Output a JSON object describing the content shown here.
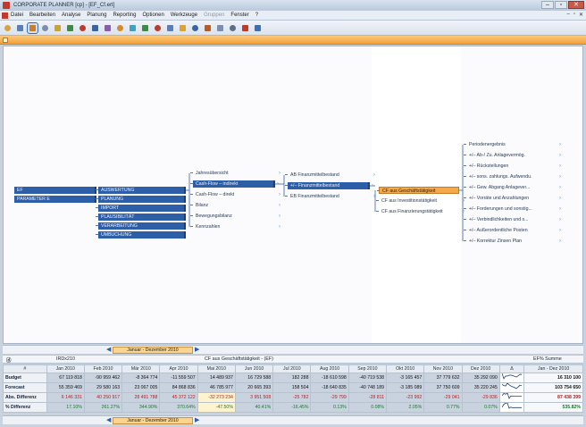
{
  "window": {
    "title": "CORPORATE PLANNER [cp] - [EF_Cf.ert]",
    "controls": [
      "–",
      "▫",
      "✕"
    ]
  },
  "menu": {
    "items": [
      {
        "label": "Datei",
        "enabled": true
      },
      {
        "label": "Bearbeiten",
        "enabled": true
      },
      {
        "label": "Analyse",
        "enabled": true
      },
      {
        "label": "Planung",
        "enabled": true
      },
      {
        "label": "Reporting",
        "enabled": true
      },
      {
        "label": "Optionen",
        "enabled": true
      },
      {
        "label": "Werkzeuge",
        "enabled": true
      },
      {
        "label": "Gruppen",
        "enabled": false
      },
      {
        "label": "Fenster",
        "enabled": true
      },
      {
        "label": "?",
        "enabled": true
      }
    ],
    "mdi_controls": [
      "–",
      "▫",
      "✕"
    ]
  },
  "toolbar": {
    "icons": [
      {
        "name": "open-icon",
        "color": "#d9a33a"
      },
      {
        "name": "tree-icon",
        "color": "#5a7fb8"
      },
      {
        "name": "structure-icon",
        "color": "#c97f2a",
        "active": true
      },
      {
        "name": "table-icon",
        "color": "#7a8fb0"
      },
      {
        "name": "report-icon",
        "color": "#c9a33a"
      },
      {
        "name": "chart-icon",
        "color": "#3f8a48"
      },
      {
        "name": "arrow-icon",
        "color": "#c0392b"
      },
      {
        "name": "plan-icon",
        "color": "#3766a8"
      },
      {
        "name": "graph-icon",
        "color": "#8a5bb5"
      },
      {
        "name": "clock-icon",
        "color": "#d58b2a"
      },
      {
        "name": "globe-icon",
        "color": "#3fa0c8"
      },
      {
        "name": "pin-icon",
        "color": "#3f8a48"
      },
      {
        "name": "line-chart-icon",
        "color": "#c0392b"
      },
      {
        "name": "grid-icon",
        "color": "#5a7fb8"
      },
      {
        "name": "calendar-icon",
        "color": "#d9a33a"
      },
      {
        "name": "nodes-icon",
        "color": "#3766a8"
      },
      {
        "name": "flow-icon",
        "color": "#b85a2a"
      },
      {
        "name": "filter-icon",
        "color": "#7a8fb0"
      },
      {
        "name": "print-icon",
        "color": "#5a6f88"
      },
      {
        "name": "save-icon",
        "color": "#c0392b"
      },
      {
        "name": "export-icon",
        "color": "#3f6fb0"
      }
    ]
  },
  "tree": {
    "col1": [
      {
        "label": "EF",
        "style": "blue"
      },
      {
        "label": "PARAMETER E",
        "style": "blue"
      }
    ],
    "col2": [
      {
        "label": "AUSWERTUNG",
        "style": "blue"
      },
      {
        "label": "PLANUNG",
        "style": "blue"
      },
      {
        "label": "IMPORT",
        "style": "blue"
      },
      {
        "label": "PLAUSIBILITÄT",
        "style": "blue"
      },
      {
        "label": "VERARBEITUNG",
        "style": "blue"
      },
      {
        "label": "UMBUCHUNG",
        "style": "blue"
      }
    ],
    "col3": [
      {
        "label": "Jahresübersicht",
        "style": "plain"
      },
      {
        "label": "Cash-Flow – indirekt",
        "style": "blue"
      },
      {
        "label": "Cash-Flow – direkt",
        "style": "plain"
      },
      {
        "label": "Bilanz",
        "style": "plain"
      },
      {
        "label": "Bewegungsbilanz",
        "style": "plain"
      },
      {
        "label": "Kennzahlen",
        "style": "plain"
      }
    ],
    "col4": [
      {
        "label": "AB Finanzmittelbestand",
        "style": "plain"
      },
      {
        "label": "+/– Finanzmittelbestand",
        "style": "blue"
      },
      {
        "label": "EB Finanzmittelbestand",
        "style": "plain"
      }
    ],
    "col5": [
      {
        "label": "CF aus Geschäftstätigkeit",
        "style": "selected"
      },
      {
        "label": "CF aus Investitionstätigkeit",
        "style": "plain"
      },
      {
        "label": "CF aus Finanzierungstätigkeit",
        "style": "plain"
      }
    ],
    "col6": [
      {
        "label": "Periodenergebnis"
      },
      {
        "label": "+/– Ab-/ Zu. Anlagevermög."
      },
      {
        "label": "+/– Rückstellungen"
      },
      {
        "label": "+/– sons. zahlungs. Aufwendu."
      },
      {
        "label": "+/– Gew. Abgang Anlagever..."
      },
      {
        "label": "+/– Vorräte und Anzahlungen"
      },
      {
        "label": "+/– Forderungen und sonstig..."
      },
      {
        "label": "+/– Verbindlichkeiten und s..."
      },
      {
        "label": "+/– Außerordentliche Posten"
      },
      {
        "label": "+/– Korrektur Zinsen Plan"
      }
    ]
  },
  "period": {
    "label": "Januar - Dezember 2010",
    "left_arrow": "◀",
    "right_arrow": "▶"
  },
  "info": {
    "version": "IRDx210",
    "object": "CF aus Geschäftstätigkeit - (EF)",
    "summary_label": "EF% Summe"
  },
  "grid": {
    "columns": [
      "Jan 2010",
      "Feb 2010",
      "Mär 2010",
      "Apr 2010",
      "Mai 2010",
      "Jun 2010",
      "Jul 2010",
      "Aug 2010",
      "Sep 2010",
      "Okt 2010",
      "Nov 2010",
      "Dez 2010"
    ],
    "sum_header": "Jan - Dez 2010",
    "rows": [
      {
        "name": "Budget",
        "values": [
          "67 119 818",
          "-90 959 462",
          "-8 364 774",
          "-11 559 507",
          "14 489 937",
          "16 729 588",
          "182 288",
          "-18 610 598",
          "-40 719 538",
          "-3 165 457",
          "37 779 632",
          "35 292 090"
        ],
        "sum": "16 310 100",
        "type": "normal"
      },
      {
        "name": "Forecast",
        "values": "55 359 469|29 580 163|23 067 005|84 868 836|46 785 977|20 665 393|158 504|-18 640 835|-40 748 189|-3 185 089|37 750 609|35 220 245",
        "sum": "103 754 650",
        "type": "normal"
      },
      {
        "name": "Abs. Differenz",
        "values": [
          "6 146 331",
          "40 250 917",
          "28 491 788",
          "45 372 122",
          "-32 273 234",
          "3 951 508",
          "-25 782",
          "-29 799",
          "-28 811",
          "-23 992",
          "-29 041",
          "-29 836"
        ],
        "sum": "87 438 399",
        "type": "neg"
      },
      {
        "name": "% Differenz",
        "values": [
          "17.10%",
          "261.27%",
          "344.90%",
          "370.64%",
          "-47.50%",
          "40.41%",
          "-16.45%",
          "0.13%",
          "0.08%",
          "2.05%",
          "0.77%",
          "0.07%"
        ],
        "sum": "535.82%",
        "type": "pct"
      }
    ],
    "row_header": "#",
    "spark_header": "Δ"
  },
  "bottom_period": {
    "label": "Januar - Dezember 2010"
  }
}
